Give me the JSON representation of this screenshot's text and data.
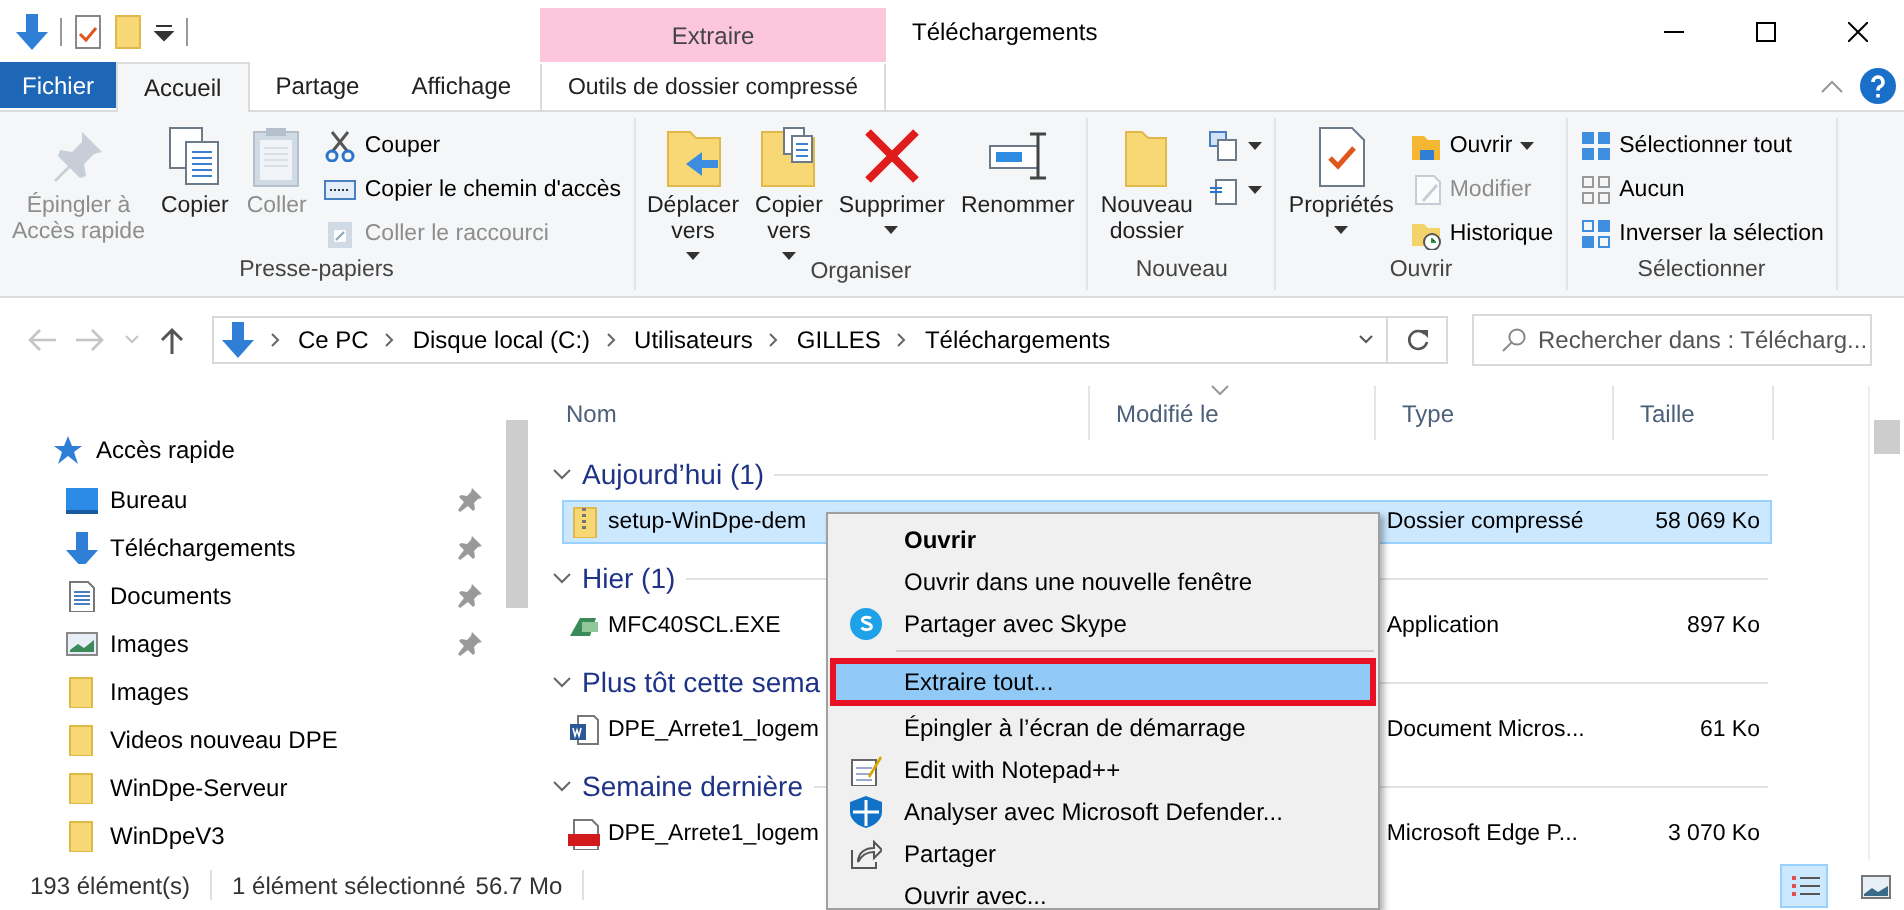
{
  "contextual_tab": {
    "header": "Extraire",
    "label": "Outils de dossier compressé"
  },
  "window": {
    "title": "Téléchargements"
  },
  "tabs": [
    {
      "label": "Fichier",
      "kind": "file",
      "selected": false
    },
    {
      "label": "Accueil",
      "kind": "tab",
      "selected": true
    },
    {
      "label": "Partage",
      "kind": "tab",
      "selected": false
    },
    {
      "label": "Affichage",
      "kind": "tab",
      "selected": false
    }
  ],
  "ribbon": {
    "groups": [
      {
        "label": "Presse-papiers",
        "commands": [
          {
            "kind": "large",
            "label": "Épingler à\nAccès rapide",
            "disabled": true,
            "dropdown": false
          },
          {
            "kind": "large",
            "label": "Copier",
            "disabled": false,
            "dropdown": false
          },
          {
            "kind": "large",
            "label": "Coller",
            "disabled": true,
            "dropdown": false
          },
          {
            "kind": "small",
            "label": "Couper",
            "disabled": false,
            "dropdown": false
          },
          {
            "kind": "small",
            "label": "Copier le chemin d'accès",
            "disabled": false,
            "dropdown": false
          },
          {
            "kind": "small",
            "label": "Coller le raccourci",
            "disabled": true,
            "dropdown": false
          }
        ]
      },
      {
        "label": "Organiser",
        "commands": [
          {
            "kind": "large",
            "label": "Déplacer\nvers",
            "disabled": false,
            "dropdown": true
          },
          {
            "kind": "large",
            "label": "Copier\nvers",
            "disabled": false,
            "dropdown": true
          },
          {
            "kind": "large",
            "label": "Supprimer",
            "disabled": false,
            "dropdown": true
          },
          {
            "kind": "large",
            "label": "Renommer",
            "disabled": false,
            "dropdown": false
          }
        ]
      },
      {
        "label": "Nouveau",
        "commands": [
          {
            "kind": "large",
            "label": "Nouveau\ndossier",
            "disabled": false,
            "dropdown": false
          },
          {
            "kind": "small",
            "disabled": false,
            "dropdown": true
          },
          {
            "kind": "small",
            "disabled": false,
            "dropdown": true
          }
        ]
      },
      {
        "label": "Ouvrir",
        "commands": [
          {
            "kind": "large",
            "label": "Propriétés",
            "disabled": false,
            "dropdown": true
          },
          {
            "kind": "small",
            "label": "Ouvrir",
            "disabled": false,
            "dropdown": true
          },
          {
            "kind": "small",
            "label": "Modifier",
            "disabled": true,
            "dropdown": false
          },
          {
            "kind": "small",
            "label": "Historique",
            "disabled": false,
            "dropdown": false
          }
        ]
      },
      {
        "label": "Sélectionner",
        "commands": [
          {
            "kind": "small",
            "label": "Sélectionner tout",
            "disabled": false,
            "dropdown": false
          },
          {
            "kind": "small",
            "label": "Aucun",
            "disabled": false,
            "dropdown": false
          },
          {
            "kind": "small",
            "label": "Inverser la sélection",
            "disabled": false,
            "dropdown": false
          }
        ]
      }
    ]
  },
  "address_bar": {
    "path": [
      "Ce PC",
      "Disque local (C:)",
      "Utilisateurs",
      "GILLES",
      "Téléchargements"
    ]
  },
  "search": {
    "placeholder": "Rechercher dans : Télécharg..."
  },
  "navigation_pane": {
    "items": [
      {
        "label": "Accès rapide",
        "children": [
          {
            "label": "Bureau",
            "pinned": true
          },
          {
            "label": "Téléchargements",
            "pinned": true
          },
          {
            "label": "Documents",
            "pinned": true
          },
          {
            "label": "Images",
            "pinned": true
          },
          {
            "label": "Images",
            "pinned": false
          },
          {
            "label": "Videos nouveau DPE",
            "pinned": false
          },
          {
            "label": "WinDpe-Serveur",
            "pinned": false
          },
          {
            "label": "WinDpeV3",
            "pinned": false
          }
        ]
      }
    ]
  },
  "file_list": {
    "columns": [
      {
        "label": "Nom",
        "sorted": false
      },
      {
        "label": "Modifié le",
        "sorted": true
      },
      {
        "label": "Type",
        "sorted": false
      },
      {
        "label": "Taille",
        "sorted": false
      }
    ],
    "groups": [
      {
        "label": "Aujourd’hui (1)",
        "expanded": true,
        "rows": [
          {
            "name": "setup-WinDpe-dem",
            "type": "Dossier compressé",
            "size": "58 069 Ko",
            "selected": true
          }
        ]
      },
      {
        "label": "Hier (1)",
        "expanded": true,
        "rows": [
          {
            "name": "MFC40SCL.EXE",
            "type": "Application",
            "size": "897 Ko",
            "selected": false
          }
        ]
      },
      {
        "label": "Plus tôt cette sema",
        "expanded": true,
        "rows": [
          {
            "name": "DPE_Arrete1_logem",
            "type": "Document Micros...",
            "size": "61 Ko",
            "selected": false
          }
        ]
      },
      {
        "label": "Semaine dernière",
        "expanded": true,
        "rows": [
          {
            "name": "DPE_Arrete1_logem",
            "type": "Microsoft Edge P...",
            "size": "3 070 Ko",
            "selected": false
          }
        ]
      }
    ]
  },
  "context_menu": {
    "items": [
      {
        "label": "Ouvrir",
        "default": true,
        "selected": false
      },
      {
        "label": "Ouvrir dans une nouvelle fenêtre",
        "default": false,
        "selected": false
      },
      {
        "label": "Partager avec Skype",
        "default": false,
        "selected": false
      },
      {
        "label": "Extraire tout...",
        "default": false,
        "selected": true
      },
      {
        "label": "Épingler à l’écran de démarrage",
        "default": false,
        "selected": false
      },
      {
        "label": "Edit with Notepad++",
        "default": false,
        "selected": false
      },
      {
        "label": "Analyser avec Microsoft Defender...",
        "default": false,
        "selected": false
      },
      {
        "label": "Partager",
        "default": false,
        "selected": false
      },
      {
        "label": "Ouvrir avec...",
        "default": false,
        "selected": false
      }
    ]
  },
  "status_bar": {
    "item_count": "193 élément(s)",
    "selection": "1 élément sélectionné",
    "selection_size": "56.7 Mo",
    "views": [
      {
        "selected": true
      },
      {
        "selected": false
      }
    ]
  }
}
